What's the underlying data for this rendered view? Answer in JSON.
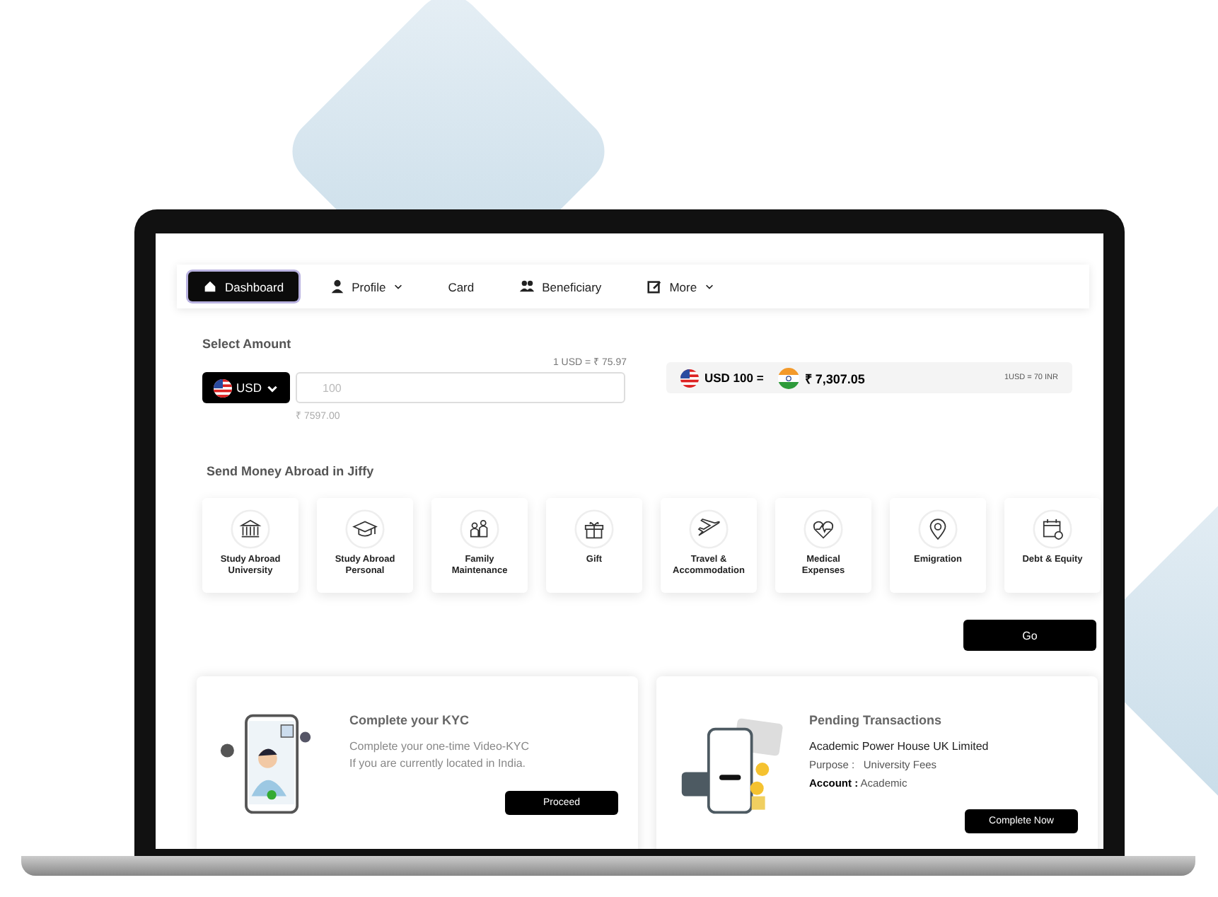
{
  "nav": {
    "items": [
      {
        "label": "Dashboard",
        "kind": "home",
        "selected": true,
        "dropdown": false
      },
      {
        "label": "Profile",
        "kind": "person",
        "selected": false,
        "dropdown": true
      },
      {
        "label": "Card",
        "kind": "plain",
        "selected": false,
        "dropdown": false
      },
      {
        "label": "Beneficiary",
        "kind": "people",
        "selected": false,
        "dropdown": false
      },
      {
        "label": "More",
        "kind": "edit",
        "selected": false,
        "dropdown": true
      }
    ]
  },
  "select_amount": {
    "title": "Select Amount",
    "rate": "1 USD = ₹ 75.97",
    "currency": "USD",
    "amount_placeholder": "100",
    "converted": "₹ 7597.00"
  },
  "conversion": {
    "from": "USD 100 =",
    "to": "₹ 7,307.05",
    "note": "1USD = 70 INR"
  },
  "purposes": {
    "title": "Send Money Abroad in Jiffy",
    "items": [
      {
        "label": "Study Abroad University",
        "kind": "bank"
      },
      {
        "label": "Study Abroad Personal",
        "kind": "cap"
      },
      {
        "label": "Family Maintenance",
        "kind": "family"
      },
      {
        "label": "Gift",
        "kind": "gift"
      },
      {
        "label": "Travel & Accommodation",
        "kind": "plane"
      },
      {
        "label": "Medical Expenses",
        "kind": "heart"
      },
      {
        "label": "Emigration",
        "kind": "pin"
      },
      {
        "label": "Debt & Equity",
        "kind": "calendar"
      }
    ]
  },
  "go_button": "Go",
  "kyc_card": {
    "title": "Complete your KYC",
    "description_lines": [
      "Complete your one-time Video-KYC",
      "If you are currently located in India."
    ],
    "button": "Proceed"
  },
  "pending_card": {
    "title": "Pending Transactions",
    "name": "Academic Power House UK Limited",
    "details": [
      "Purpose :   University Fees",
      "**Account :** Academic"
    ],
    "button": "Complete Now"
  }
}
